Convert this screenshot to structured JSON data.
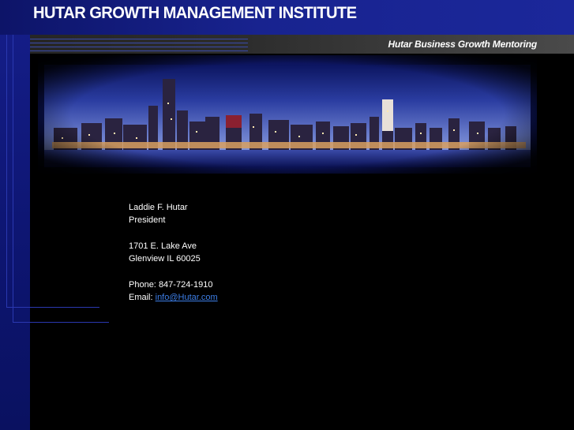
{
  "header": {
    "title": "HUTAR GROWTH MANAGEMENT INSTITUTE"
  },
  "tagline": "Hutar Business Growth Mentoring",
  "contact": {
    "name": "Laddie F. Hutar",
    "role": "President",
    "address_line1": "1701 E. Lake Ave",
    "address_line2": "Glenview IL 60025",
    "phone_label": "Phone:",
    "phone": "847-724-1910",
    "email_label": "Email:",
    "email": "info@Hutar.com"
  },
  "colors": {
    "page_background": "#000000",
    "header_blue": "#18238f",
    "tagline_bar": "#2d2d2d",
    "link": "#3d7fe8",
    "text": "#ffffff"
  }
}
